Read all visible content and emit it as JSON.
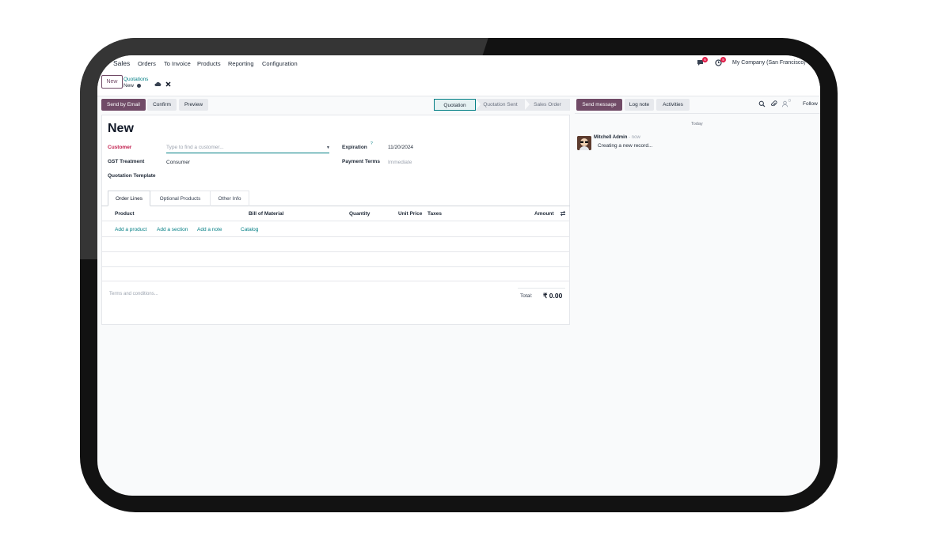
{
  "nav": {
    "app": "Sales",
    "menu": [
      "Orders",
      "To Invoice",
      "Products",
      "Reporting",
      "Configuration"
    ],
    "messages_count": "6",
    "activities_count": "9",
    "company": "My Company (San Francisco)"
  },
  "control": {
    "new_button": "New",
    "breadcrumb_parent": "Quotations",
    "breadcrumb_current": "New"
  },
  "actions": {
    "send_email": "Send by Email",
    "confirm": "Confirm",
    "preview": "Preview"
  },
  "status": [
    "Quotation",
    "Quotation Sent",
    "Sales Order"
  ],
  "status_active": "Quotation",
  "chatter": {
    "send_message": "Send message",
    "log_note": "Log note",
    "activities": "Activities",
    "followers_count": "0",
    "follow": "Follow",
    "date_separator": "Today",
    "message": {
      "author": "Mitchell Admin",
      "time": "- now",
      "body": "Creating a new record..."
    }
  },
  "form": {
    "title": "New",
    "customer_label": "Customer",
    "customer_placeholder": "Type to find a customer...",
    "gst_label": "GST Treatment",
    "gst_value": "Consumer",
    "template_label": "Quotation Template",
    "expiration_label": "Expiration",
    "expiration_help": "?",
    "expiration_value": "11/20/2024",
    "payment_terms_label": "Payment Terms",
    "payment_terms_placeholder": "Immediate"
  },
  "tabs": [
    "Order Lines",
    "Optional Products",
    "Other Info"
  ],
  "table": {
    "headers": [
      "Product",
      "Bill of Material",
      "Quantity",
      "Unit Price",
      "Taxes",
      "Amount"
    ],
    "add_links": [
      "Add a product",
      "Add a section",
      "Add a note",
      "Catalog"
    ]
  },
  "footer": {
    "terms_placeholder": "Terms and conditions...",
    "total_label": "Total:",
    "total_value": "₹ 0.00"
  },
  "colors": {
    "primary": "#714b67",
    "teal": "#017e84",
    "required": "#c11b4b",
    "badge": "#e11d48"
  }
}
